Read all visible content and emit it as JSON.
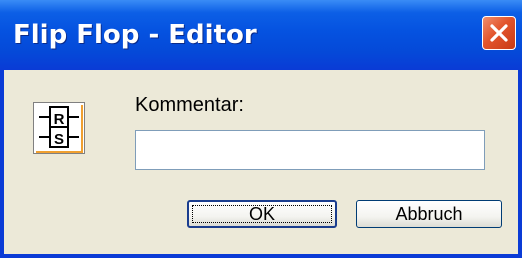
{
  "window": {
    "title": "Flip Flop - Editor"
  },
  "icon": {
    "name": "rs-flip-flop-icon",
    "r_label": "R",
    "s_label": "S"
  },
  "form": {
    "comment_label": "Kommentar:",
    "comment_value": ""
  },
  "buttons": {
    "ok_label": "OK",
    "cancel_label": "Abbruch"
  },
  "colors": {
    "titlebar": "#0552e0",
    "close": "#e2542c",
    "dialog_bg": "#ece9d8"
  }
}
